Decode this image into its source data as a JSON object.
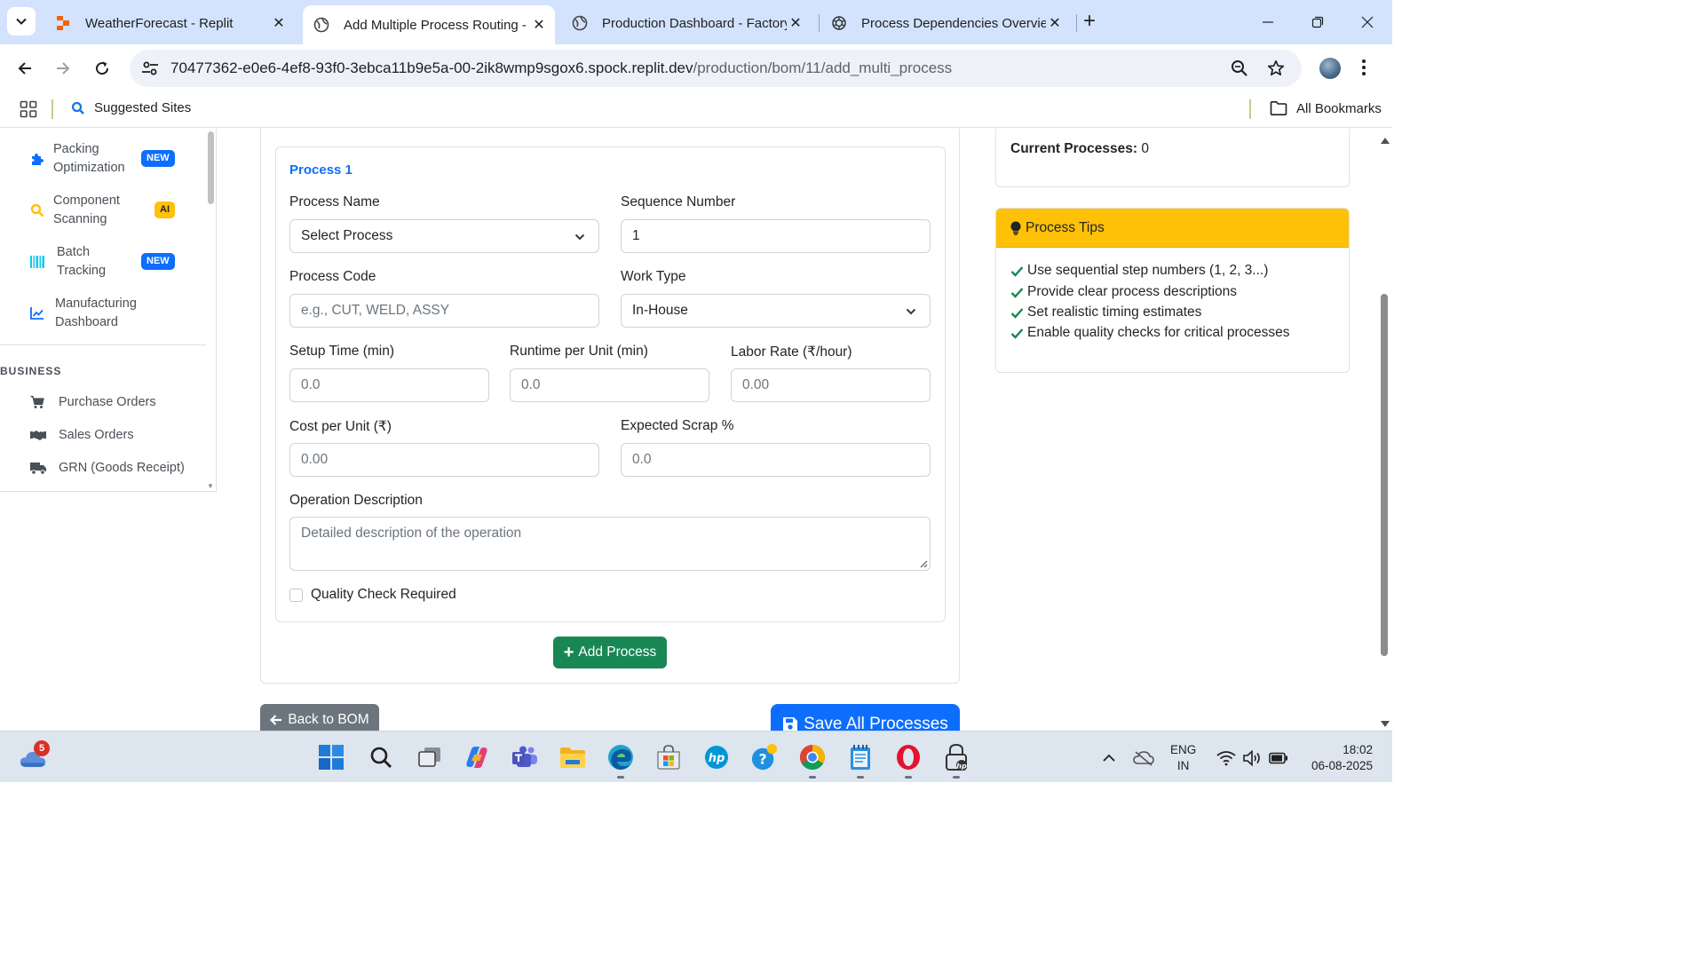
{
  "browser": {
    "tabs": [
      {
        "title": "WeatherForecast - Replit",
        "favicon": "replit-icon",
        "active": false
      },
      {
        "title": "Add Multiple Process Routing -",
        "favicon": "globe-icon",
        "active": true
      },
      {
        "title": "Production Dashboard - Factory",
        "favicon": "globe-icon",
        "active": false
      },
      {
        "title": "Process Dependencies Overview",
        "favicon": "openai-icon",
        "active": false
      }
    ],
    "url_host": "70477362-e0e6-4ef8-93f0-3ebca11b9e5a-00-2ik8wmp9sgox6.spock.replit.dev",
    "url_path": "/production/bom/11/add_multi_process",
    "bookmarks": {
      "suggested": "Suggested Sites",
      "all": "All Bookmarks"
    }
  },
  "sidebar": {
    "items": [
      {
        "label": "Packing Optimization",
        "badge": "NEW",
        "icon": "puzzle-icon"
      },
      {
        "label": "Component Scanning",
        "badge": "AI",
        "icon": "search-icon"
      },
      {
        "label": "Batch Tracking",
        "badge": "NEW",
        "icon": "barcode-icon"
      },
      {
        "label": "Manufacturing Dashboard",
        "badge": "",
        "icon": "chart-line-icon"
      }
    ],
    "section": "BUSINESS",
    "business_links": [
      {
        "label": "Purchase Orders",
        "icon": "cart-icon"
      },
      {
        "label": "Sales Orders",
        "icon": "handshake-icon"
      },
      {
        "label": "GRN (Goods Receipt)",
        "icon": "truck-icon"
      }
    ]
  },
  "form": {
    "process_title": "Process 1",
    "process_name_label": "Process Name",
    "process_name_value": "Select Process",
    "sequence_label": "Sequence Number",
    "sequence_value": "1",
    "process_code_label": "Process Code",
    "process_code_placeholder": "e.g., CUT, WELD, ASSY",
    "work_type_label": "Work Type",
    "work_type_value": "In-House",
    "setup_time_label": "Setup Time (min)",
    "setup_time_placeholder": "0.0",
    "runtime_label": "Runtime per Unit (min)",
    "runtime_placeholder": "0.0",
    "labor_rate_label": "Labor Rate (₹/hour)",
    "labor_rate_placeholder": "0.00",
    "cost_label": "Cost per Unit (₹)",
    "cost_placeholder": "0.00",
    "scrap_label": "Expected Scrap %",
    "scrap_placeholder": "0.0",
    "description_label": "Operation Description",
    "description_placeholder": "Detailed description of the operation",
    "quality_label": "Quality Check Required",
    "quality_checked": false,
    "add_button": "Add Process",
    "back_button": "Back to BOM",
    "save_button": "Save All Processes"
  },
  "info": {
    "current_label": "Current Processes:",
    "current_value": "0"
  },
  "tips": {
    "title": "Process Tips",
    "items": [
      "Use sequential step numbers (1, 2, 3...)",
      "Provide clear process descriptions",
      "Set realistic timing estimates",
      "Enable quality checks for critical processes"
    ]
  },
  "taskbar": {
    "weather_badge": "5",
    "lang_line1": "ENG",
    "lang_line2": "IN",
    "time": "18:02",
    "date": "06-08-2025"
  },
  "colors": {
    "primary": "#0d6efd",
    "success": "#198754",
    "warning": "#ffc107",
    "secondary": "#6c757d",
    "chrome_tabstrip": "#d3e3fd"
  }
}
